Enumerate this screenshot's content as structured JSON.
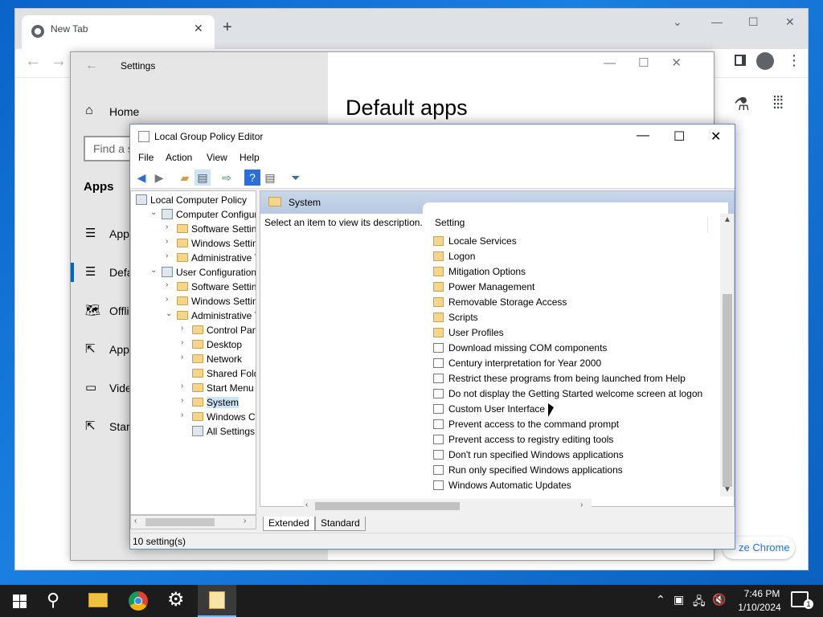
{
  "chrome": {
    "tab_title": "New Tab",
    "tab_close": "✕",
    "new_tab": "+",
    "collapse": "⌄",
    "minimize": "—",
    "maximize": "☐",
    "close": "✕",
    "back": "←",
    "forward": "→",
    "menu": "⋮",
    "labs_icon": "⚗",
    "apps_icon": "⁞⁞⁞",
    "customize_label": "ze Chrome"
  },
  "settings": {
    "back": "←",
    "title": "Settings",
    "window_controls": "—☐✕",
    "home_icon": "⌂",
    "home": "Home",
    "search_placeholder": "Find a s",
    "section": "Apps",
    "items": [
      {
        "icon": "☰",
        "label": "Apps"
      },
      {
        "icon": "☰",
        "label": "Defa"
      },
      {
        "icon": "🗺",
        "label": "Offli"
      },
      {
        "icon": "⇱",
        "label": "App"
      },
      {
        "icon": "▭",
        "label": "Vide"
      },
      {
        "icon": "⇱",
        "label": "Start"
      }
    ],
    "heading": "Default apps"
  },
  "gpe": {
    "title": "Local Group Policy Editor",
    "minimize": "—",
    "maximize": "☐",
    "close": "✕",
    "menu": [
      "File",
      "Action",
      "View",
      "Help"
    ],
    "tree": [
      {
        "label": "Local Computer Policy",
        "arrow": "",
        "icon": "node",
        "indent": 0
      },
      {
        "label": "Computer Configura",
        "arrow": "⌄",
        "icon": "node",
        "indent": 1
      },
      {
        "label": "Software Settings",
        "arrow": "›",
        "icon": "folder",
        "indent": 2
      },
      {
        "label": "Windows Setting",
        "arrow": "›",
        "icon": "folder",
        "indent": 2
      },
      {
        "label": "Administrative Te",
        "arrow": "›",
        "icon": "folder",
        "indent": 2
      },
      {
        "label": "User Configuration",
        "arrow": "⌄",
        "icon": "node",
        "indent": 1
      },
      {
        "label": "Software Settings",
        "arrow": "›",
        "icon": "folder",
        "indent": 2
      },
      {
        "label": "Windows Setting",
        "arrow": "›",
        "icon": "folder",
        "indent": 2
      },
      {
        "label": "Administrative Te",
        "arrow": "⌄",
        "icon": "folder",
        "indent": 2
      },
      {
        "label": "Control Panel",
        "arrow": "›",
        "icon": "folder",
        "indent": 3
      },
      {
        "label": "Desktop",
        "arrow": "›",
        "icon": "folder",
        "indent": 3
      },
      {
        "label": "Network",
        "arrow": "›",
        "icon": "folder",
        "indent": 3
      },
      {
        "label": "Shared Folder",
        "arrow": "",
        "icon": "folder",
        "indent": 3
      },
      {
        "label": "Start Menu ar",
        "arrow": "›",
        "icon": "folder",
        "indent": 3
      },
      {
        "label": "System",
        "arrow": "›",
        "icon": "folder",
        "indent": 3,
        "selected": true
      },
      {
        "label": "Windows Cor",
        "arrow": "›",
        "icon": "folder",
        "indent": 3
      },
      {
        "label": "All Settings",
        "arrow": "",
        "icon": "node",
        "indent": 3
      }
    ],
    "content_header": "System",
    "description": "Select an item to view its description.",
    "column_header": "Setting",
    "settings": [
      {
        "label": "Locale Services",
        "type": "folder"
      },
      {
        "label": "Logon",
        "type": "folder"
      },
      {
        "label": "Mitigation Options",
        "type": "folder"
      },
      {
        "label": "Power Management",
        "type": "folder"
      },
      {
        "label": "Removable Storage Access",
        "type": "folder"
      },
      {
        "label": "Scripts",
        "type": "folder"
      },
      {
        "label": "User Profiles",
        "type": "folder"
      },
      {
        "label": "Download missing COM components",
        "type": "policy"
      },
      {
        "label": "Century interpretation for Year 2000",
        "type": "policy"
      },
      {
        "label": "Restrict these programs from being launched from Help",
        "type": "policy"
      },
      {
        "label": "Do not display the Getting Started welcome screen at logon",
        "type": "policy"
      },
      {
        "label": "Custom User Interface",
        "type": "policy"
      },
      {
        "label": "Prevent access to the command prompt",
        "type": "policy"
      },
      {
        "label": "Prevent access to registry editing tools",
        "type": "policy"
      },
      {
        "label": "Don't run specified Windows applications",
        "type": "policy"
      },
      {
        "label": "Run only specified Windows applications",
        "type": "policy"
      },
      {
        "label": "Windows Automatic Updates",
        "type": "policy"
      }
    ],
    "tabs": [
      "Extended",
      "Standard"
    ],
    "status": "10 setting(s)"
  },
  "taskbar": {
    "search_icon": "⚲",
    "settings_icon": "⚙",
    "tray_chevron": "⌃",
    "tray_network": "🖧",
    "tray_volume": "🔇",
    "time": "7:46 PM",
    "date": "1/10/2024",
    "notif_count": "1"
  },
  "colors": {
    "desktop": "#0a63c9",
    "accent": "#0067c0",
    "selection": "#cce4f7",
    "folder": "#f5d58a"
  }
}
